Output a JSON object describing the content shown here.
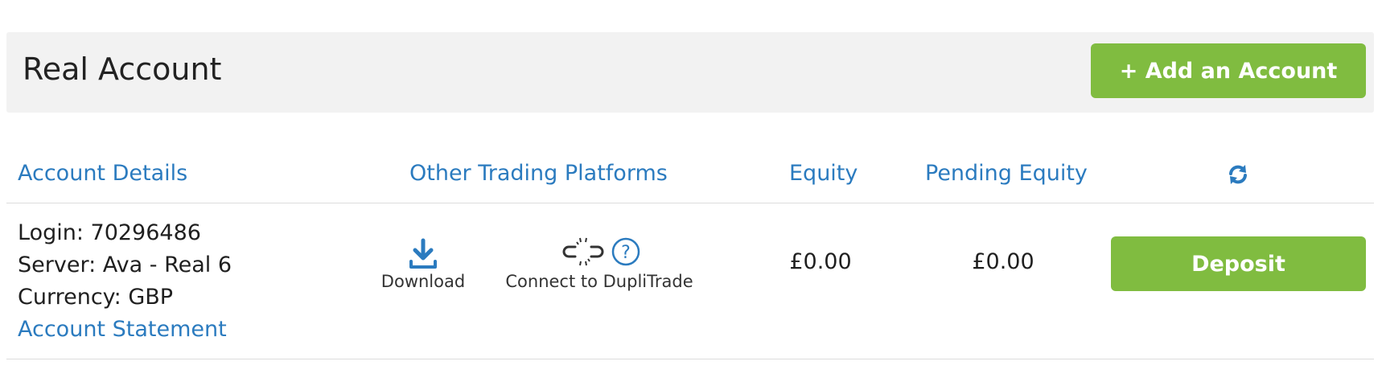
{
  "header": {
    "title": "Real Account",
    "add_account_label": "+ Add an Account"
  },
  "columns": {
    "account_details": "Account Details",
    "other_platforms": "Other Trading Platforms",
    "equity": "Equity",
    "pending_equity": "Pending Equity",
    "refresh_icon": "refresh-icon"
  },
  "account": {
    "login": "Login: 70296486",
    "server": "Server: Ava - Real 6",
    "currency": "Currency: GBP",
    "statement_link": "Account Statement",
    "platforms": {
      "download_label": "Download",
      "download_icon": "download-icon",
      "duplitrade_label": "Connect to DupliTrade",
      "duplitrade_icon": "broken-link-icon",
      "help_icon": "question-circle-icon"
    },
    "equity": "£0.00",
    "pending_equity": "£0.00",
    "deposit_label": "Deposit"
  },
  "colors": {
    "accent_green": "#80bc40",
    "link_blue": "#2b7bbf",
    "header_bg": "#f2f2f2"
  }
}
